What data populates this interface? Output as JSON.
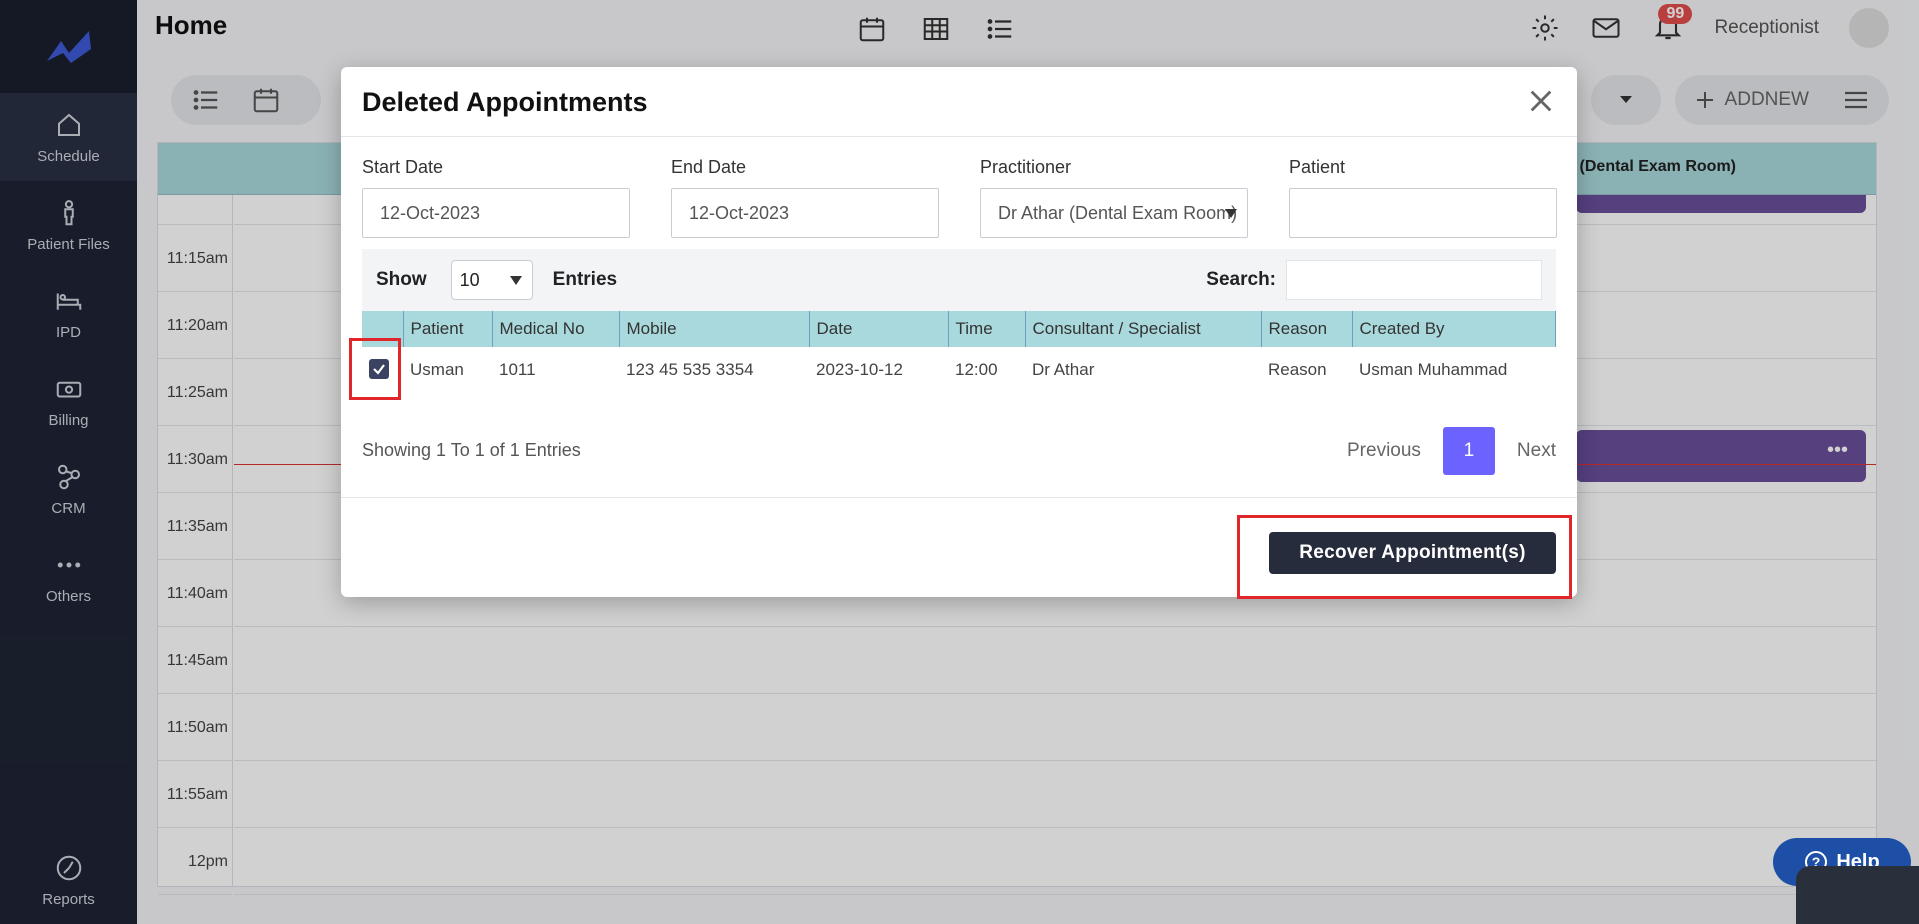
{
  "sidebar": {
    "items": [
      {
        "label": "Schedule",
        "icon": "home-icon"
      },
      {
        "label": "Patient Files",
        "icon": "person-icon"
      },
      {
        "label": "IPD",
        "icon": "bed-icon"
      },
      {
        "label": "Billing",
        "icon": "money-icon"
      },
      {
        "label": "CRM",
        "icon": "network-icon"
      },
      {
        "label": "Others",
        "icon": "dots-icon"
      }
    ],
    "bottom_label": "Reports"
  },
  "header": {
    "title": "Home",
    "notification_count": "99",
    "user_role": "Receptionist",
    "add_new_label": "ADDNEW"
  },
  "schedule": {
    "column_title": "(Dental Exam Room)",
    "times": [
      "11:15am",
      "11:20am",
      "11:25am",
      "11:30am",
      "11:35am",
      "11:40am",
      "11:45am",
      "11:50am",
      "11:55am",
      "12pm"
    ],
    "appointment_menu": "•••"
  },
  "modal": {
    "title": "Deleted Appointments",
    "filters": {
      "start_date_label": "Start Date",
      "start_date_value": "12-Oct-2023",
      "end_date_label": "End Date",
      "end_date_value": "12-Oct-2023",
      "practitioner_label": "Practitioner",
      "practitioner_value": "Dr Athar (Dental Exam Room)",
      "patient_label": "Patient",
      "patient_value": ""
    },
    "datatable": {
      "show_label": "Show",
      "page_size": "10",
      "entries_label": "Entries",
      "search_label": "Search:",
      "columns": [
        "Patient",
        "Medical No",
        "Mobile",
        "Date",
        "Time",
        "Consultant / Specialist",
        "Reason",
        "Created By"
      ],
      "rows": [
        {
          "checked": true,
          "patient": "Usman",
          "medical_no": "1011",
          "mobile": "123 45 535 3354",
          "date": "2023-10-12",
          "time": "12:00",
          "consultant": "Dr Athar",
          "reason": "Reason",
          "created_by": "Usman Muhammad"
        }
      ],
      "info": "Showing 1 To 1 of 1 Entries",
      "prev_label": "Previous",
      "current_page": "1",
      "next_label": "Next"
    },
    "recover_button": "Recover Appointment(s)"
  },
  "help_label": "Help",
  "colors": {
    "sidebar": "#1f2435",
    "accent": "#6c63ff",
    "table_header": "#a9d9dc",
    "highlight": "#e0262b"
  }
}
